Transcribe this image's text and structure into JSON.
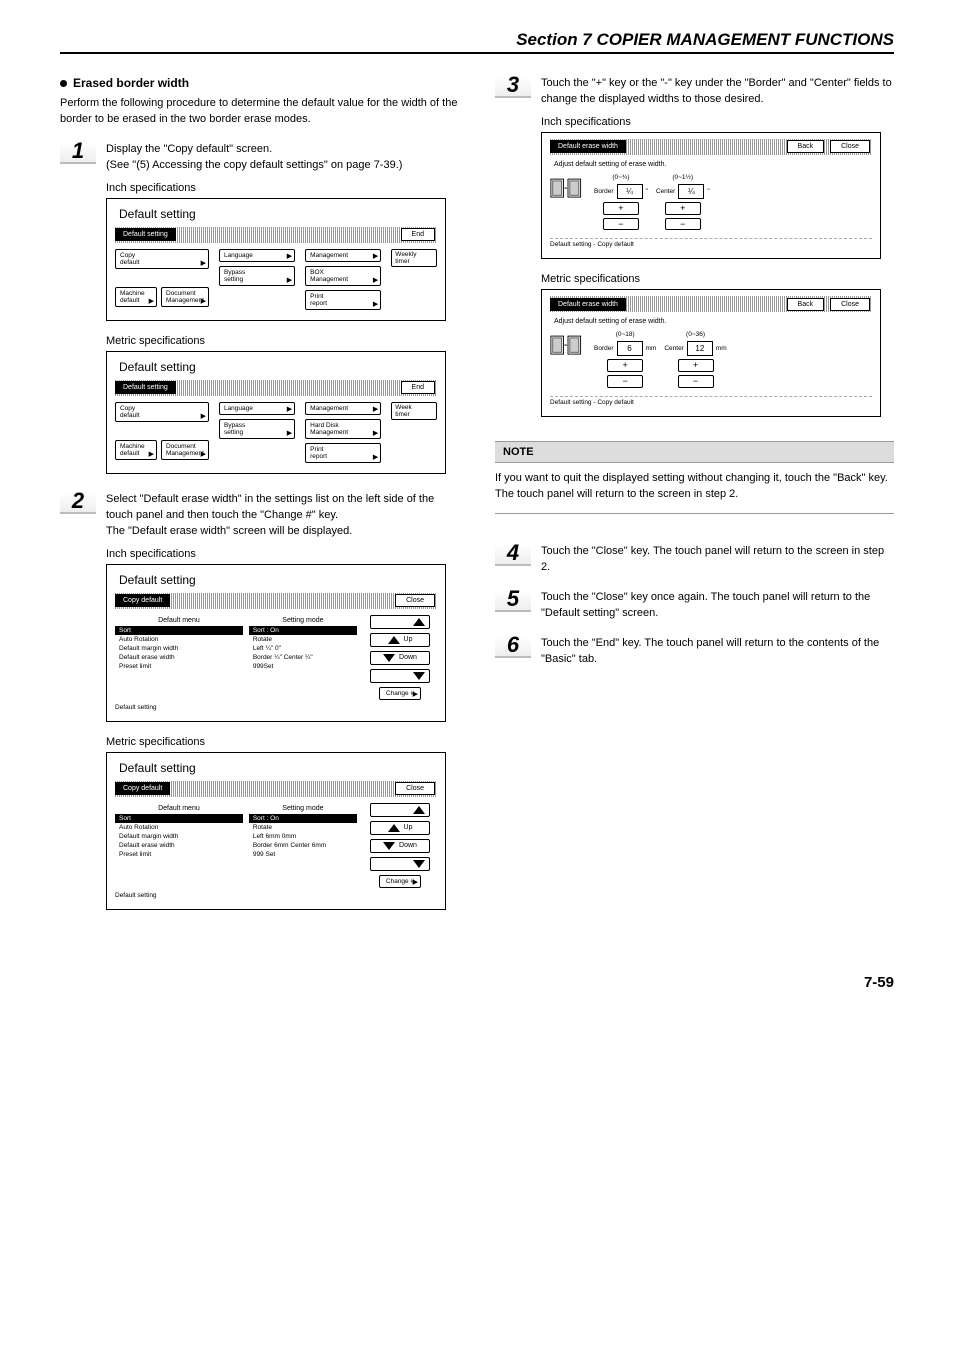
{
  "header": {
    "section_title": "Section 7  COPIER MANAGEMENT FUNCTIONS"
  },
  "left": {
    "subhead": "Erased border width",
    "intro": "Perform the following procedure to determine the default value for the width of the border to be erased in the two border erase modes.",
    "step1": {
      "num": "1",
      "line1": "Display the \"Copy default\" screen.",
      "line2": "(See \"(5) Accessing the copy default settings\" on page 7-39.)"
    },
    "inch_label": "Inch specifications",
    "metric_label": "Metric specifications",
    "panelA": {
      "title": "Default setting",
      "bar_label": "Default setting",
      "end": "End",
      "copy_default": "Copy\ndefault",
      "machine_default": "Machine\ndefault",
      "document_mgmt": "Document\nManagement",
      "language": "Language",
      "bypass": "Bypass\nsetting",
      "management": "Management",
      "box_mgmt": "BOX\nManagement",
      "hdd_mgmt": "Hard Disk\nManagement",
      "print_report": "Print\nreport",
      "weekly_timer": "Weekly\ntimer",
      "week_timer": "Week\ntimer"
    },
    "step2": {
      "num": "2",
      "text": "Select \"Default erase width\" in the settings list on the left side of the touch panel and then touch the \"Change #\" key.\nThe \"Default erase width\" screen will be displayed."
    },
    "panelB": {
      "title": "Default setting",
      "bar_label": "Copy default",
      "close": "Close",
      "menu_head": "Default menu",
      "mode_head": "Setting mode",
      "rows_inch": [
        {
          "m": "Sort",
          "v": "Sort : On",
          "dark": true
        },
        {
          "m": "Auto Rotation",
          "v": "Rotate"
        },
        {
          "m": "Default margin width",
          "v": "Left ¼\"    0\""
        },
        {
          "m": "Default erase width",
          "v": "Border ¼\"   Center ¼\""
        },
        {
          "m": "Preset limit",
          "v": "999Set"
        }
      ],
      "rows_metric": [
        {
          "m": "Sort",
          "v": "Sort : On",
          "dark": true
        },
        {
          "m": "Auto Rotation",
          "v": "Rotate"
        },
        {
          "m": "Default margin width",
          "v": "Left 6mm    0mm"
        },
        {
          "m": "Default erase width",
          "v": "Border 6mm  Center 6mm"
        },
        {
          "m": "Preset limit",
          "v": "999 Set"
        }
      ],
      "up": "Up",
      "down": "Down",
      "change": "Change #",
      "footer": "Default setting"
    }
  },
  "right": {
    "step3": {
      "num": "3",
      "text": "Touch the \"+\" key or the \"-\" key under the \"Border\" and \"Center\" fields to change the displayed widths to those desired."
    },
    "panelC": {
      "bar_label": "Default erase width",
      "back": "Back",
      "close": "Close",
      "instr": "Adjust default setting of erase width.",
      "border": "Border",
      "center": "Center",
      "inch": {
        "range1": "(0~¾)",
        "range2": "(0~1½)",
        "val1": "¼",
        "val2": "¼",
        "unit": "\""
      },
      "metric": {
        "range1": "(0~18)",
        "range2": "(0~36)",
        "val1": "6",
        "val2": "12",
        "unit": "mm"
      },
      "footer": "Default setting - Copy default"
    },
    "note_head": "NOTE",
    "note_body": "If you want to quit the displayed setting without changing it, touch the \"Back\" key. The touch panel will return to the screen in step 2.",
    "step4": {
      "num": "4",
      "text": "Touch the \"Close\" key. The touch panel will return to the screen in step 2."
    },
    "step5": {
      "num": "5",
      "text": "Touch the \"Close\" key once again. The touch panel will return to the \"Default setting\" screen."
    },
    "step6": {
      "num": "6",
      "text": "Touch the \"End\" key. The touch panel will return to the contents of the \"Basic\" tab."
    }
  },
  "page_num": "7-59"
}
